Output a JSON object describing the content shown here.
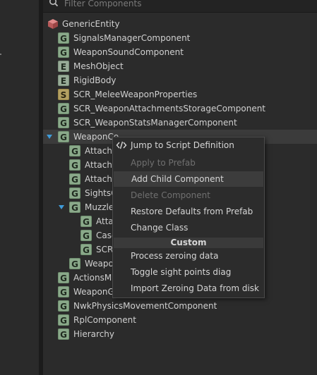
{
  "search": {
    "placeholder": "Filter Components"
  },
  "tree": {
    "root_label": "GenericEntity",
    "items": [
      {
        "label": "SignalsManagerComponent",
        "icon": "G"
      },
      {
        "label": "WeaponSoundComponent",
        "icon": "G"
      },
      {
        "label": "MeshObject",
        "icon": "E"
      },
      {
        "label": "RigidBody",
        "icon": "E"
      },
      {
        "label": "SCR_MeleeWeaponProperties",
        "icon": "S"
      },
      {
        "label": "SCR_WeaponAttachmentsStorageComponent",
        "icon": "G"
      },
      {
        "label": "SCR_WeaponStatsManagerComponent",
        "icon": "G"
      },
      {
        "label": "WeaponCo",
        "icon": "G"
      },
      {
        "label": "Attachr",
        "icon": "G"
      },
      {
        "label": "Attachr",
        "icon": "G"
      },
      {
        "label": "Attachr",
        "icon": "G"
      },
      {
        "label": "SightsC",
        "icon": "G"
      },
      {
        "label": "Muzzle",
        "icon": "G"
      },
      {
        "label": "Atta",
        "icon": "G"
      },
      {
        "label": "Case",
        "icon": "G"
      },
      {
        "label": "SCR",
        "icon": "G"
      },
      {
        "label": "Weapo",
        "icon": "G"
      },
      {
        "label": "ActionsMa",
        "icon": "G"
      },
      {
        "label": "WeaponGa",
        "icon": "G"
      },
      {
        "label": "NwkPhysicsMovementComponent",
        "icon": "G"
      },
      {
        "label": "RplComponent",
        "icon": "G"
      },
      {
        "label": "Hierarchy",
        "icon": "G"
      }
    ]
  },
  "context_menu": {
    "jump": "Jump to Script Definition",
    "apply": "Apply to Prefab",
    "add_child": "Add Child Component",
    "delete": "Delete Component",
    "restore": "Restore Defaults from Prefab",
    "change_class": "Change Class",
    "section_custom": "Custom",
    "process": "Process zeroing data",
    "toggle": "Toggle sight points diag",
    "import": "Import Zeroing Data from disk"
  },
  "colors": {
    "accent": "#3f9bd8",
    "g_icon": "#8aa98a",
    "s_icon": "#b3a062"
  }
}
